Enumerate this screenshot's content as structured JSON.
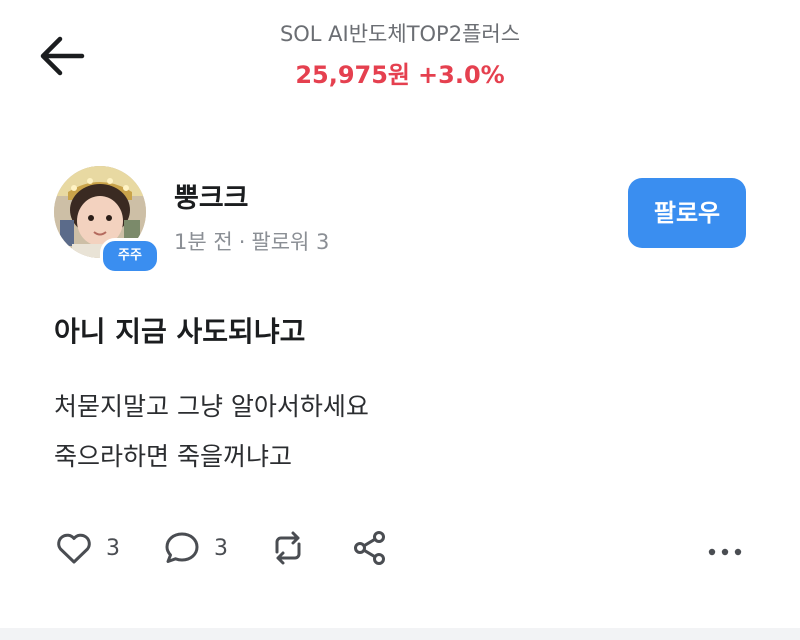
{
  "header": {
    "back_icon": "arrow-left-icon",
    "stock_name": "SOL AI반도체TOP2플러스",
    "price": "25,975원",
    "change": "+3.0%",
    "price_color": "#e5404f"
  },
  "author": {
    "name": "뿡크크",
    "badge": "주주",
    "time": "1분 전",
    "separator": "·",
    "followers": "팔로워 3",
    "follow_label": "팔로우",
    "accent": "#3a8ef0"
  },
  "post": {
    "title": "아니 지금 사도되냐고",
    "body_lines": [
      "처묻지말고 그냥 알아서하세요",
      "죽으라하면 죽을꺼냐고"
    ]
  },
  "actions": {
    "like_icon": "heart-icon",
    "like_count": "3",
    "comment_icon": "comment-icon",
    "comment_count": "3",
    "repost_icon": "repost-icon",
    "share_icon": "share-icon",
    "more_icon": "more-dots-icon"
  }
}
